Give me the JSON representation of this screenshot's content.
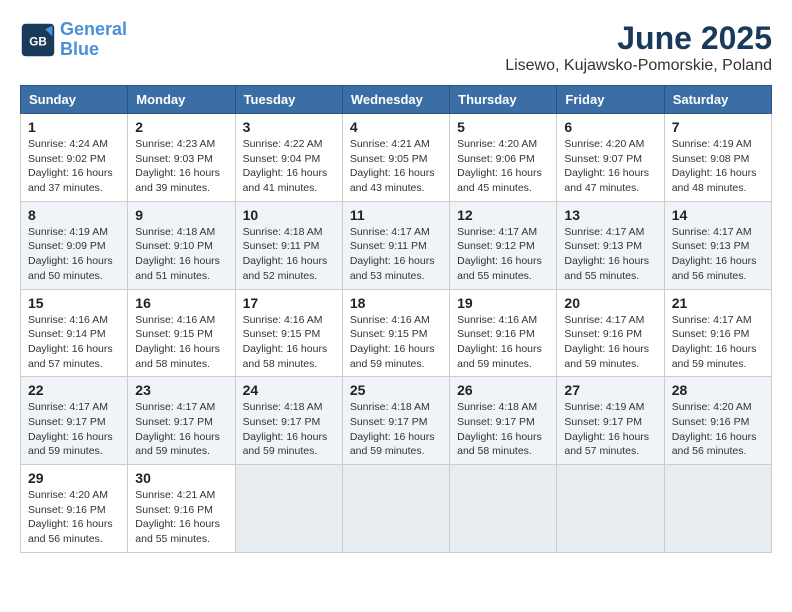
{
  "header": {
    "logo_line1": "General",
    "logo_line2": "Blue",
    "main_title": "June 2025",
    "subtitle": "Lisewo, Kujawsko-Pomorskie, Poland"
  },
  "calendar": {
    "days_of_week": [
      "Sunday",
      "Monday",
      "Tuesday",
      "Wednesday",
      "Thursday",
      "Friday",
      "Saturday"
    ],
    "weeks": [
      [
        null,
        {
          "day": "2",
          "sunrise": "4:23 AM",
          "sunset": "9:03 PM",
          "daylight": "16 hours and 39 minutes."
        },
        {
          "day": "3",
          "sunrise": "4:22 AM",
          "sunset": "9:04 PM",
          "daylight": "16 hours and 41 minutes."
        },
        {
          "day": "4",
          "sunrise": "4:21 AM",
          "sunset": "9:05 PM",
          "daylight": "16 hours and 43 minutes."
        },
        {
          "day": "5",
          "sunrise": "4:20 AM",
          "sunset": "9:06 PM",
          "daylight": "16 hours and 45 minutes."
        },
        {
          "day": "6",
          "sunrise": "4:20 AM",
          "sunset": "9:07 PM",
          "daylight": "16 hours and 47 minutes."
        },
        {
          "day": "7",
          "sunrise": "4:19 AM",
          "sunset": "9:08 PM",
          "daylight": "16 hours and 48 minutes."
        }
      ],
      [
        {
          "day": "1",
          "sunrise": "4:24 AM",
          "sunset": "9:02 PM",
          "daylight": "16 hours and 37 minutes."
        },
        {
          "day": "8",
          "sunrise": "4:19 AM",
          "sunset": "9:09 PM",
          "daylight": "16 hours and 50 minutes."
        },
        {
          "day": "9",
          "sunrise": "4:18 AM",
          "sunset": "9:10 PM",
          "daylight": "16 hours and 51 minutes."
        },
        {
          "day": "10",
          "sunrise": "4:18 AM",
          "sunset": "9:11 PM",
          "daylight": "16 hours and 52 minutes."
        },
        {
          "day": "11",
          "sunrise": "4:17 AM",
          "sunset": "9:11 PM",
          "daylight": "16 hours and 53 minutes."
        },
        {
          "day": "12",
          "sunrise": "4:17 AM",
          "sunset": "9:12 PM",
          "daylight": "16 hours and 55 minutes."
        },
        {
          "day": "13",
          "sunrise": "4:17 AM",
          "sunset": "9:13 PM",
          "daylight": "16 hours and 55 minutes."
        },
        {
          "day": "14",
          "sunrise": "4:17 AM",
          "sunset": "9:13 PM",
          "daylight": "16 hours and 56 minutes."
        }
      ],
      [
        {
          "day": "15",
          "sunrise": "4:16 AM",
          "sunset": "9:14 PM",
          "daylight": "16 hours and 57 minutes."
        },
        {
          "day": "16",
          "sunrise": "4:16 AM",
          "sunset": "9:15 PM",
          "daylight": "16 hours and 58 minutes."
        },
        {
          "day": "17",
          "sunrise": "4:16 AM",
          "sunset": "9:15 PM",
          "daylight": "16 hours and 58 minutes."
        },
        {
          "day": "18",
          "sunrise": "4:16 AM",
          "sunset": "9:15 PM",
          "daylight": "16 hours and 59 minutes."
        },
        {
          "day": "19",
          "sunrise": "4:16 AM",
          "sunset": "9:16 PM",
          "daylight": "16 hours and 59 minutes."
        },
        {
          "day": "20",
          "sunrise": "4:17 AM",
          "sunset": "9:16 PM",
          "daylight": "16 hours and 59 minutes."
        },
        {
          "day": "21",
          "sunrise": "4:17 AM",
          "sunset": "9:16 PM",
          "daylight": "16 hours and 59 minutes."
        }
      ],
      [
        {
          "day": "22",
          "sunrise": "4:17 AM",
          "sunset": "9:17 PM",
          "daylight": "16 hours and 59 minutes."
        },
        {
          "day": "23",
          "sunrise": "4:17 AM",
          "sunset": "9:17 PM",
          "daylight": "16 hours and 59 minutes."
        },
        {
          "day": "24",
          "sunrise": "4:18 AM",
          "sunset": "9:17 PM",
          "daylight": "16 hours and 59 minutes."
        },
        {
          "day": "25",
          "sunrise": "4:18 AM",
          "sunset": "9:17 PM",
          "daylight": "16 hours and 59 minutes."
        },
        {
          "day": "26",
          "sunrise": "4:18 AM",
          "sunset": "9:17 PM",
          "daylight": "16 hours and 58 minutes."
        },
        {
          "day": "27",
          "sunrise": "4:19 AM",
          "sunset": "9:17 PM",
          "daylight": "16 hours and 57 minutes."
        },
        {
          "day": "28",
          "sunrise": "4:20 AM",
          "sunset": "9:16 PM",
          "daylight": "16 hours and 56 minutes."
        }
      ],
      [
        {
          "day": "29",
          "sunrise": "4:20 AM",
          "sunset": "9:16 PM",
          "daylight": "16 hours and 56 minutes."
        },
        {
          "day": "30",
          "sunrise": "4:21 AM",
          "sunset": "9:16 PM",
          "daylight": "16 hours and 55 minutes."
        },
        null,
        null,
        null,
        null,
        null
      ]
    ]
  }
}
